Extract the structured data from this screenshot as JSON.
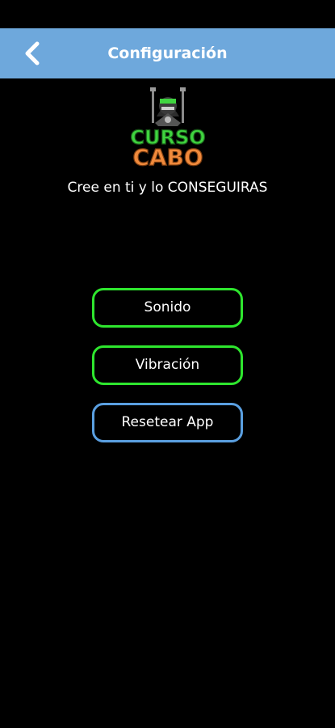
{
  "colors": {
    "nav_bar": "#6ea8dc",
    "background": "#000000",
    "button_green_border": "#2ee62e",
    "button_blue_border": "#5a9fe0",
    "logo_green": "#3fd43f",
    "logo_orange": "#f08a3c"
  },
  "header": {
    "title": "Configuración",
    "back_icon": "chevron-left-icon"
  },
  "logo": {
    "line1": "CURSO",
    "line2": "CABO"
  },
  "tagline": "Cree en ti y lo CONSEGUIRAS",
  "options": {
    "sound_label": "Sonido",
    "vibration_label": "Vibración",
    "reset_label": "Resetear App"
  }
}
